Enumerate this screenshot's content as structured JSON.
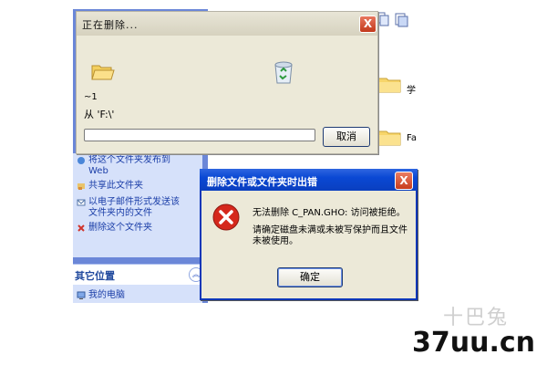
{
  "explorer": {
    "tasks": [
      {
        "label": "将这个文件夹发布到"
      },
      {
        "label": "Web"
      },
      {
        "label": "共享此文件夹"
      },
      {
        "label": "以电子邮件形式发送该"
      },
      {
        "label": "文件夹内的文件"
      },
      {
        "label": "删除这个文件夹"
      }
    ],
    "other_places_title": "其它位置",
    "other_places_items": [
      {
        "label": "我的电脑"
      }
    ],
    "files": [
      {
        "label": "学"
      },
      {
        "label": "Fa"
      }
    ]
  },
  "progress_dialog": {
    "title": "正在删除...",
    "close_label": "X",
    "file_name": "~1",
    "from_text": "从 'F:\\'",
    "progress": 0,
    "cancel_label": "取消"
  },
  "error_dialog": {
    "title": "删除文件或文件夹时出错",
    "close_label": "X",
    "message_line1": "无法删除 C_PAN.GHO: 访问被拒绝。",
    "message_line2": "请确定磁盘未满或未被写保护而且文件未被使用。",
    "ok_label": "确定"
  },
  "watermark": {
    "faint": "十巴兔",
    "main": "37uu.cn"
  }
}
